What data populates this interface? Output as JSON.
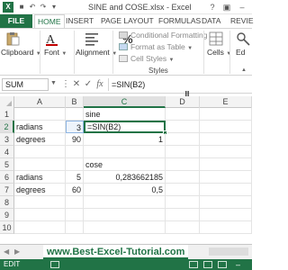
{
  "window": {
    "title": "SINE and COSE.xlsx - Excel",
    "logo_letter": "X",
    "help_label": "?"
  },
  "quick_access": [
    "save-icon",
    "undo-icon",
    "redo-icon",
    "customize-icon"
  ],
  "ribbon_tabs": [
    "FILE",
    "HOME",
    "INSERT",
    "PAGE LAYOUT",
    "FORMULAS",
    "DATA",
    "REVIE"
  ],
  "ribbon": {
    "clipboard": "Clipboard",
    "font": "Font",
    "alignment": "Alignment",
    "number": "Number",
    "conditional_formatting": "Conditional Formatting",
    "format_as_table": "Format as Table",
    "cell_styles": "Cell Styles",
    "styles": "Styles",
    "cells": "Cells",
    "editing": "Ed"
  },
  "formula_bar": {
    "name_box": "SUM",
    "cancel": "✕",
    "enter": "✓",
    "fx": "fx",
    "formula": "=SIN(B2)"
  },
  "columns": [
    "A",
    "B",
    "C",
    "D",
    "E"
  ],
  "rows": [
    "1",
    "2",
    "3",
    "4",
    "5",
    "6",
    "7",
    "8",
    "9",
    "10"
  ],
  "cells": {
    "C1": "sine",
    "A2": "radians",
    "B2": "3",
    "C2": "=SIN(B2)",
    "A3": "degrees",
    "B3": "90",
    "C3": "1",
    "C5": "cose",
    "A6": "radians",
    "B6": "5",
    "C6": "0,283662185",
    "A7": "degrees",
    "B7": "60",
    "C7": "0,5"
  },
  "watermark": "www.Best-Excel-Tutorial.com",
  "status": "EDIT",
  "colors": {
    "excel_green": "#217346",
    "selected_cell_border": "#217346",
    "referenced_cell_border": "#8db4e2"
  }
}
